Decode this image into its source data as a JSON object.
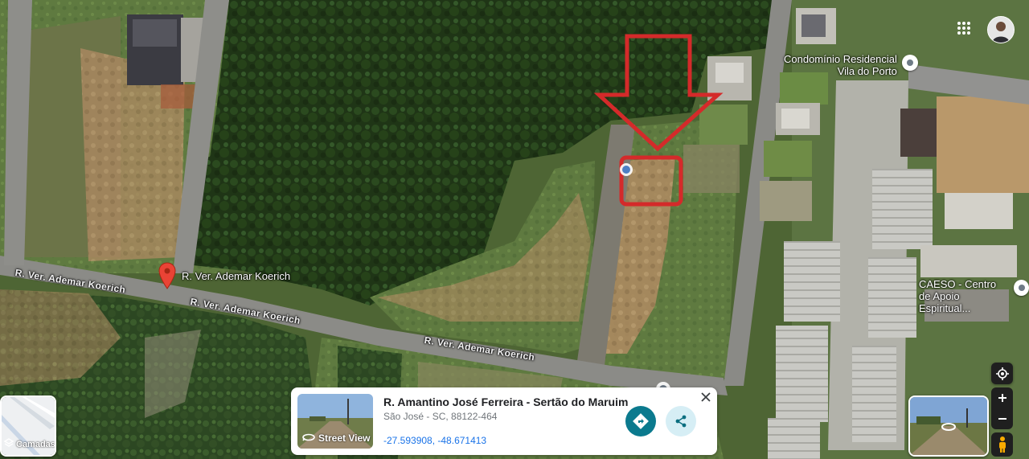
{
  "map": {
    "streets": [
      {
        "label": "R. Ver. Ademar Koerich"
      },
      {
        "label": "R. Ver. Ademar Koerich"
      },
      {
        "label": "R. Ver. Ademar Koerich"
      }
    ],
    "pin_label": "R. Ver. Ademar Koerich",
    "pois": [
      {
        "line1": "Condomínio Residencial",
        "line2": "Vila do Porto"
      },
      {
        "line1": "CAESO - Centro",
        "line2": "de Apoio Espiritual..."
      }
    ],
    "annotation_color": "#d42a2a",
    "pin_color": "#ea4335"
  },
  "controls": {
    "layers_label": "Camadas",
    "apps_icon": "apps-grid-icon",
    "avatar_icon": "avatar"
  },
  "card": {
    "title": "R. Amantino José Ferreira - Sertão do Maruim",
    "subtitle": "São José - SC, 88122-464",
    "coords": "-27.593908, -48.671413",
    "thumb_label": "Street View",
    "accent": "#0b7a8e"
  }
}
